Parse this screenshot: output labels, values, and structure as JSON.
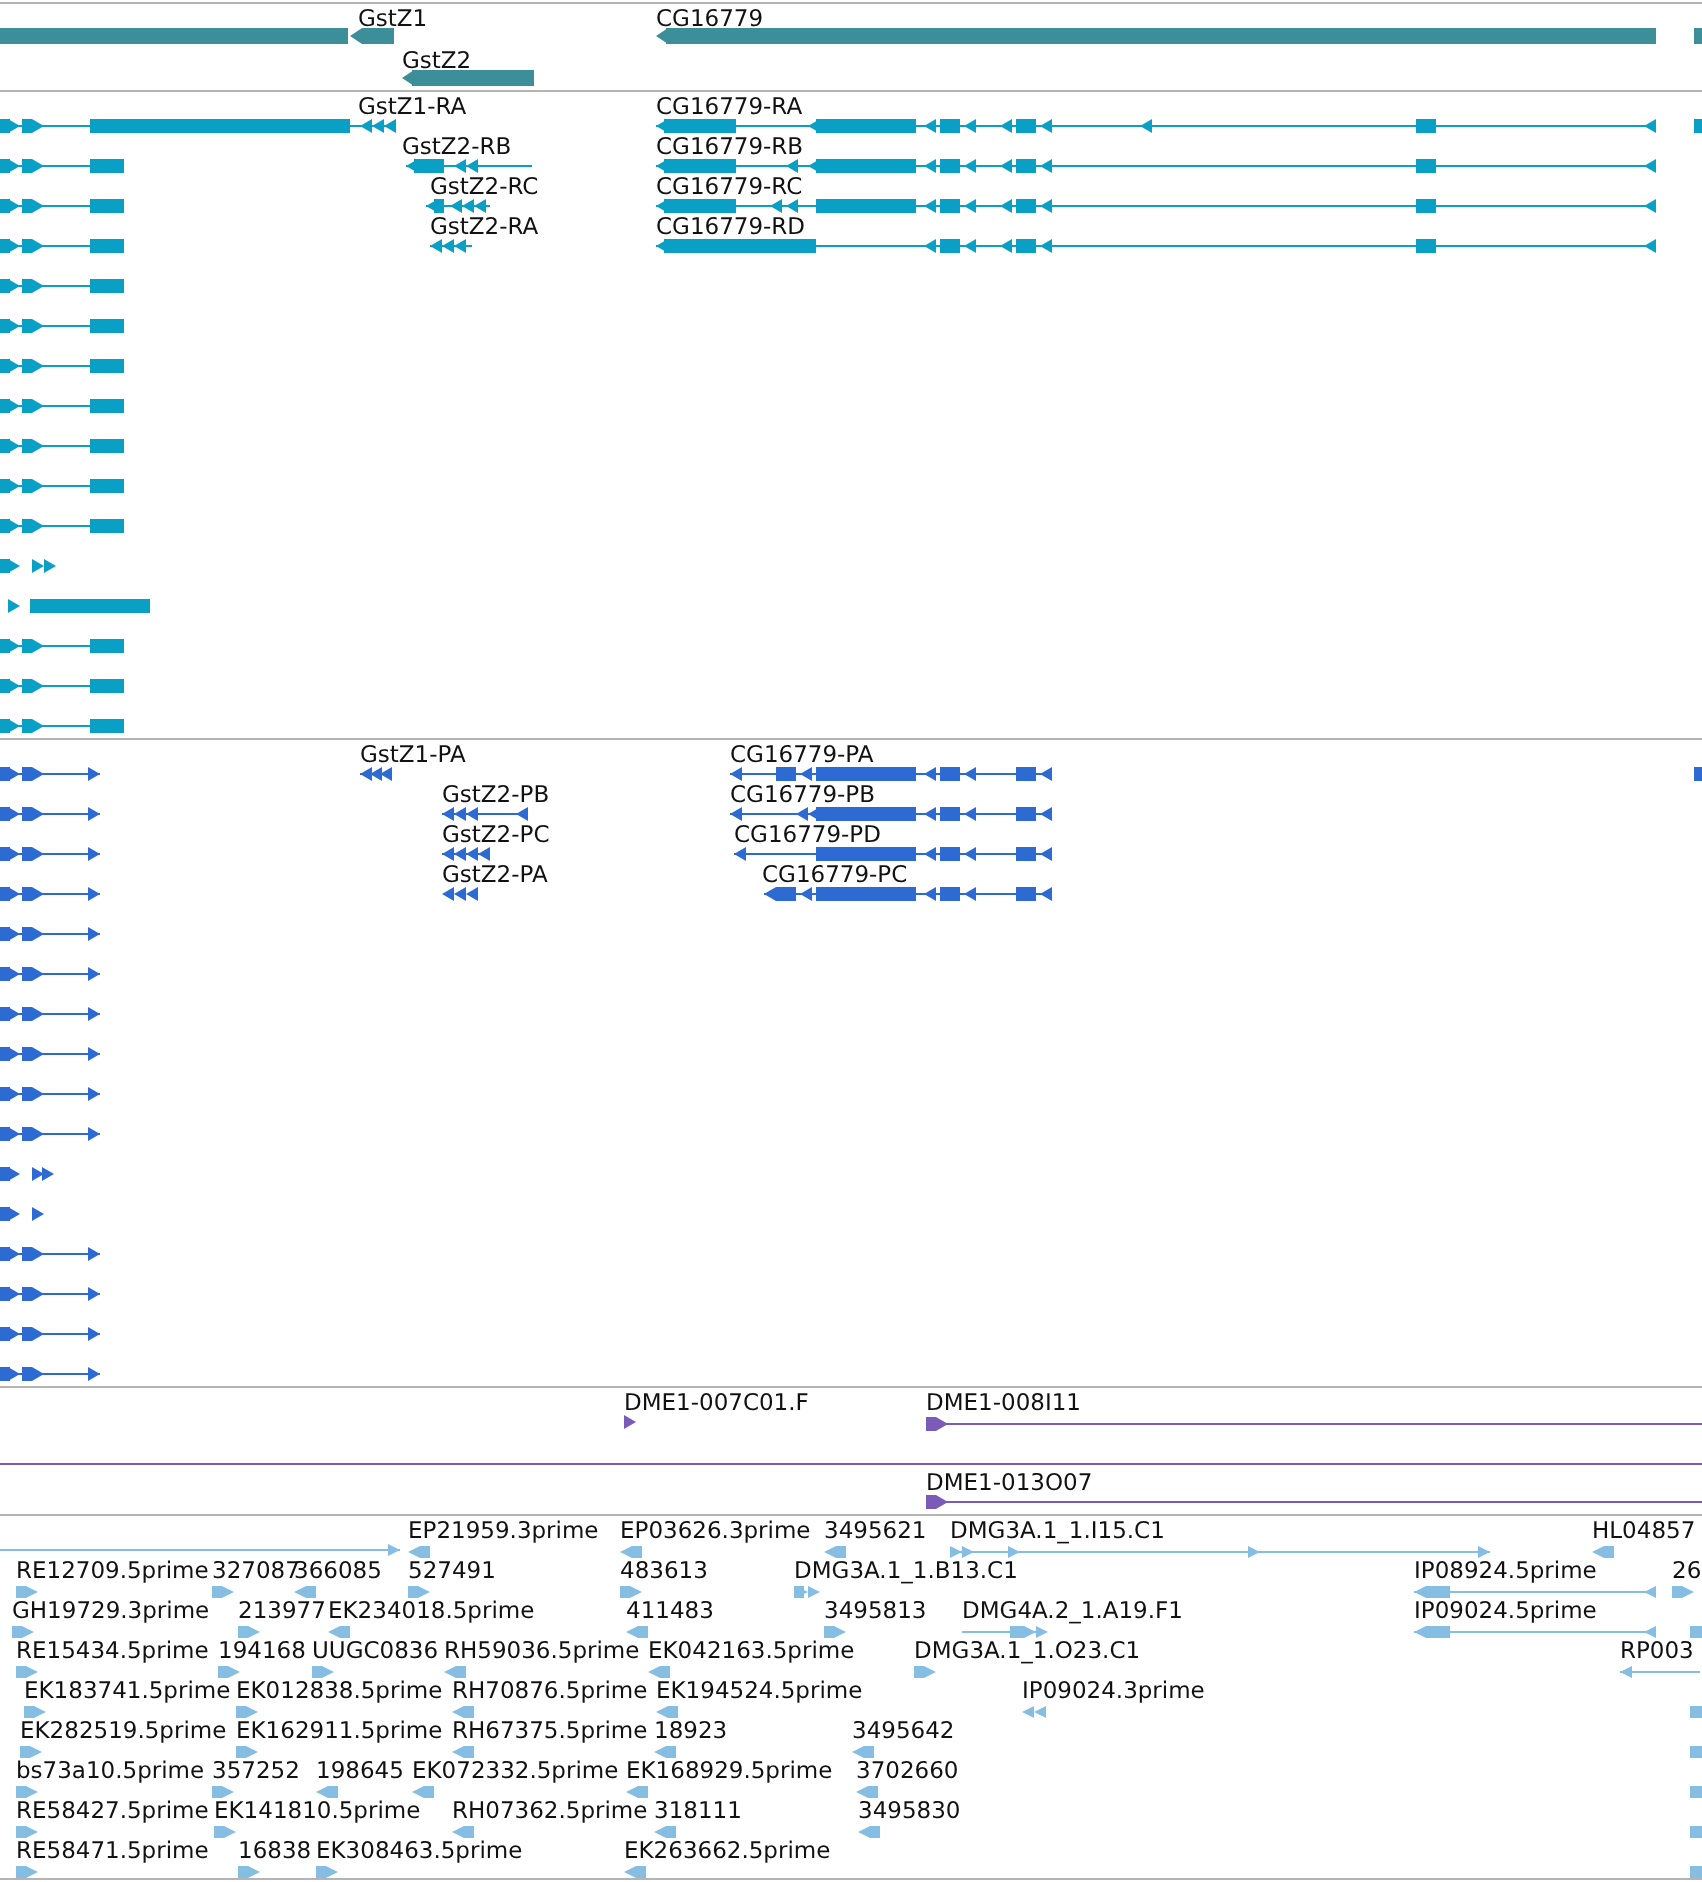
{
  "tracks": [
    {
      "kind": "gene",
      "features": [
        {
          "label": "GstZ1",
          "reverse": true
        },
        {
          "label": "GstZ2",
          "reverse": true
        },
        {
          "label": "CG16779",
          "reverse": true
        }
      ]
    },
    {
      "kind": "transcript",
      "features": [
        {
          "label": "GstZ1-RA",
          "reverse": true
        },
        {
          "label": "GstZ2-RB",
          "reverse": true
        },
        {
          "label": "GstZ2-RC",
          "reverse": true
        },
        {
          "label": "GstZ2-RA",
          "reverse": true
        },
        {
          "label": "CG16779-RA",
          "reverse": true
        },
        {
          "label": "CG16779-RB",
          "reverse": true
        },
        {
          "label": "CG16779-RC",
          "reverse": true
        },
        {
          "label": "CG16779-RD",
          "reverse": true
        }
      ]
    },
    {
      "kind": "protein",
      "features": [
        {
          "label": "GstZ1-PA",
          "reverse": true
        },
        {
          "label": "GstZ2-PB",
          "reverse": true
        },
        {
          "label": "GstZ2-PC",
          "reverse": true
        },
        {
          "label": "GstZ2-PA",
          "reverse": true
        },
        {
          "label": "CG16779-PA",
          "reverse": true
        },
        {
          "label": "CG16779-PB",
          "reverse": true
        },
        {
          "label": "CG16779-PD",
          "reverse": true
        },
        {
          "label": "CG16779-PC",
          "reverse": true
        }
      ]
    },
    {
      "kind": "clone",
      "features": [
        {
          "label": "DME1-007C01.F",
          "reverse": false
        },
        {
          "label": "DME1-008I11",
          "reverse": false
        },
        {
          "label": "DME1-013O07",
          "reverse": false
        }
      ]
    },
    {
      "kind": "est",
      "features": [
        {
          "label": "EP21959.3prime",
          "reverse": true
        },
        {
          "label": "EP03626.3prime",
          "reverse": true
        },
        {
          "label": "3495621",
          "reverse": true
        },
        {
          "label": "DMG3A.1_1.I15.C1",
          "reverse": false
        },
        {
          "label": "HL04857",
          "reverse": true
        },
        {
          "label": "RE12709.5prime",
          "reverse": false
        },
        {
          "label": "327087",
          "reverse": false
        },
        {
          "label": "366085",
          "reverse": true
        },
        {
          "label": "527491",
          "reverse": false
        },
        {
          "label": "483613",
          "reverse": false
        },
        {
          "label": "DMG3A.1_1.B13.C1",
          "reverse": false
        },
        {
          "label": "IP08924.5prime",
          "reverse": true
        },
        {
          "label": "26",
          "reverse": false
        },
        {
          "label": "GH19729.3prime",
          "reverse": false
        },
        {
          "label": "213977",
          "reverse": false
        },
        {
          "label": "EK234018.5prime",
          "reverse": true
        },
        {
          "label": "411483",
          "reverse": true
        },
        {
          "label": "3495813",
          "reverse": false
        },
        {
          "label": "DMG4A.2_1.A19.F1",
          "reverse": false
        },
        {
          "label": "IP09024.5prime",
          "reverse": true
        },
        {
          "label": "RE15434.5prime",
          "reverse": false
        },
        {
          "label": "194168",
          "reverse": false
        },
        {
          "label": "UUGC0836",
          "reverse": false
        },
        {
          "label": "RH59036.5prime",
          "reverse": true
        },
        {
          "label": "EK042163.5prime",
          "reverse": true
        },
        {
          "label": "DMG3A.1_1.O23.C1",
          "reverse": false
        },
        {
          "label": "RP003",
          "reverse": true
        },
        {
          "label": "EK183741.5prime",
          "reverse": false
        },
        {
          "label": "EK012838.5prime",
          "reverse": false
        },
        {
          "label": "RH70876.5prime",
          "reverse": true
        },
        {
          "label": "EK194524.5prime",
          "reverse": true
        },
        {
          "label": "IP09024.3prime",
          "reverse": true
        },
        {
          "label": "EK282519.5prime",
          "reverse": false
        },
        {
          "label": "EK162911.5prime",
          "reverse": false
        },
        {
          "label": "RH67375.5prime",
          "reverse": true
        },
        {
          "label": "18923",
          "reverse": true
        },
        {
          "label": "3495642",
          "reverse": true
        },
        {
          "label": "bs73a10.5prime",
          "reverse": false
        },
        {
          "label": "357252",
          "reverse": false
        },
        {
          "label": "198645",
          "reverse": true
        },
        {
          "label": "EK072332.5prime",
          "reverse": true
        },
        {
          "label": "EK168929.5prime",
          "reverse": true
        },
        {
          "label": "3702660",
          "reverse": true
        },
        {
          "label": "RE58427.5prime",
          "reverse": false
        },
        {
          "label": "EK141810.5prime",
          "reverse": false
        },
        {
          "label": "RH07362.5prime",
          "reverse": true
        },
        {
          "label": "318111",
          "reverse": true
        },
        {
          "label": "3495830",
          "reverse": true
        },
        {
          "label": "RE58471.5prime",
          "reverse": false
        },
        {
          "label": "16838",
          "reverse": false
        },
        {
          "label": "EK308463.5prime",
          "reverse": false
        },
        {
          "label": "EK263662.5prime",
          "reverse": true
        }
      ]
    }
  ]
}
